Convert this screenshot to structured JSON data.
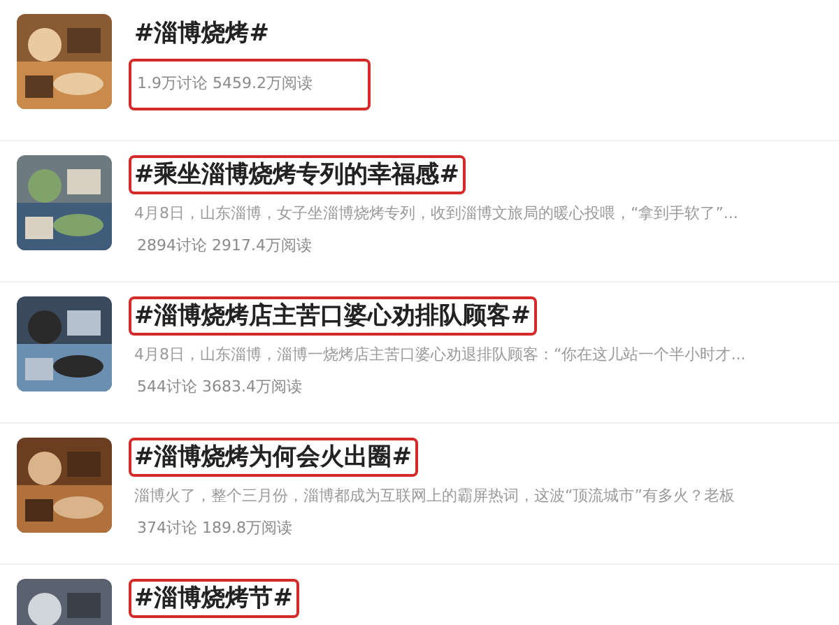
{
  "topics": [
    {
      "title": "#淄博烧烤#",
      "stats": "1.9万讨论 5459.2万阅读",
      "title_highlighted": false,
      "stats_highlighted": true
    },
    {
      "title": "#乘坐淄博烧烤专列的幸福感#",
      "summary": "4月8日，山东淄博，女子坐淄博烧烤专列，收到淄博文旅局的暖心投喂，“拿到手软了”...",
      "stats": "2894讨论 2917.4万阅读",
      "title_highlighted": true,
      "stats_highlighted": false
    },
    {
      "title": "#淄博烧烤店主苦口婆心劝排队顾客#",
      "summary": "4月8日，山东淄博，淄博一烧烤店主苦口婆心劝退排队顾客：“你在这儿站一个半小时才...",
      "stats": "544讨论 3683.4万阅读",
      "title_highlighted": true,
      "stats_highlighted": false
    },
    {
      "title": "#淄博烧烤为何会火出圈#",
      "summary": "淄博火了，整个三月份，淄博都成为互联网上的霸屏热词，这波“顶流城市”有多火？老板",
      "stats": "374讨论 189.8万阅读",
      "title_highlighted": true,
      "stats_highlighted": false
    },
    {
      "title": "#淄博烧烤节#",
      "title_highlighted": true
    }
  ]
}
